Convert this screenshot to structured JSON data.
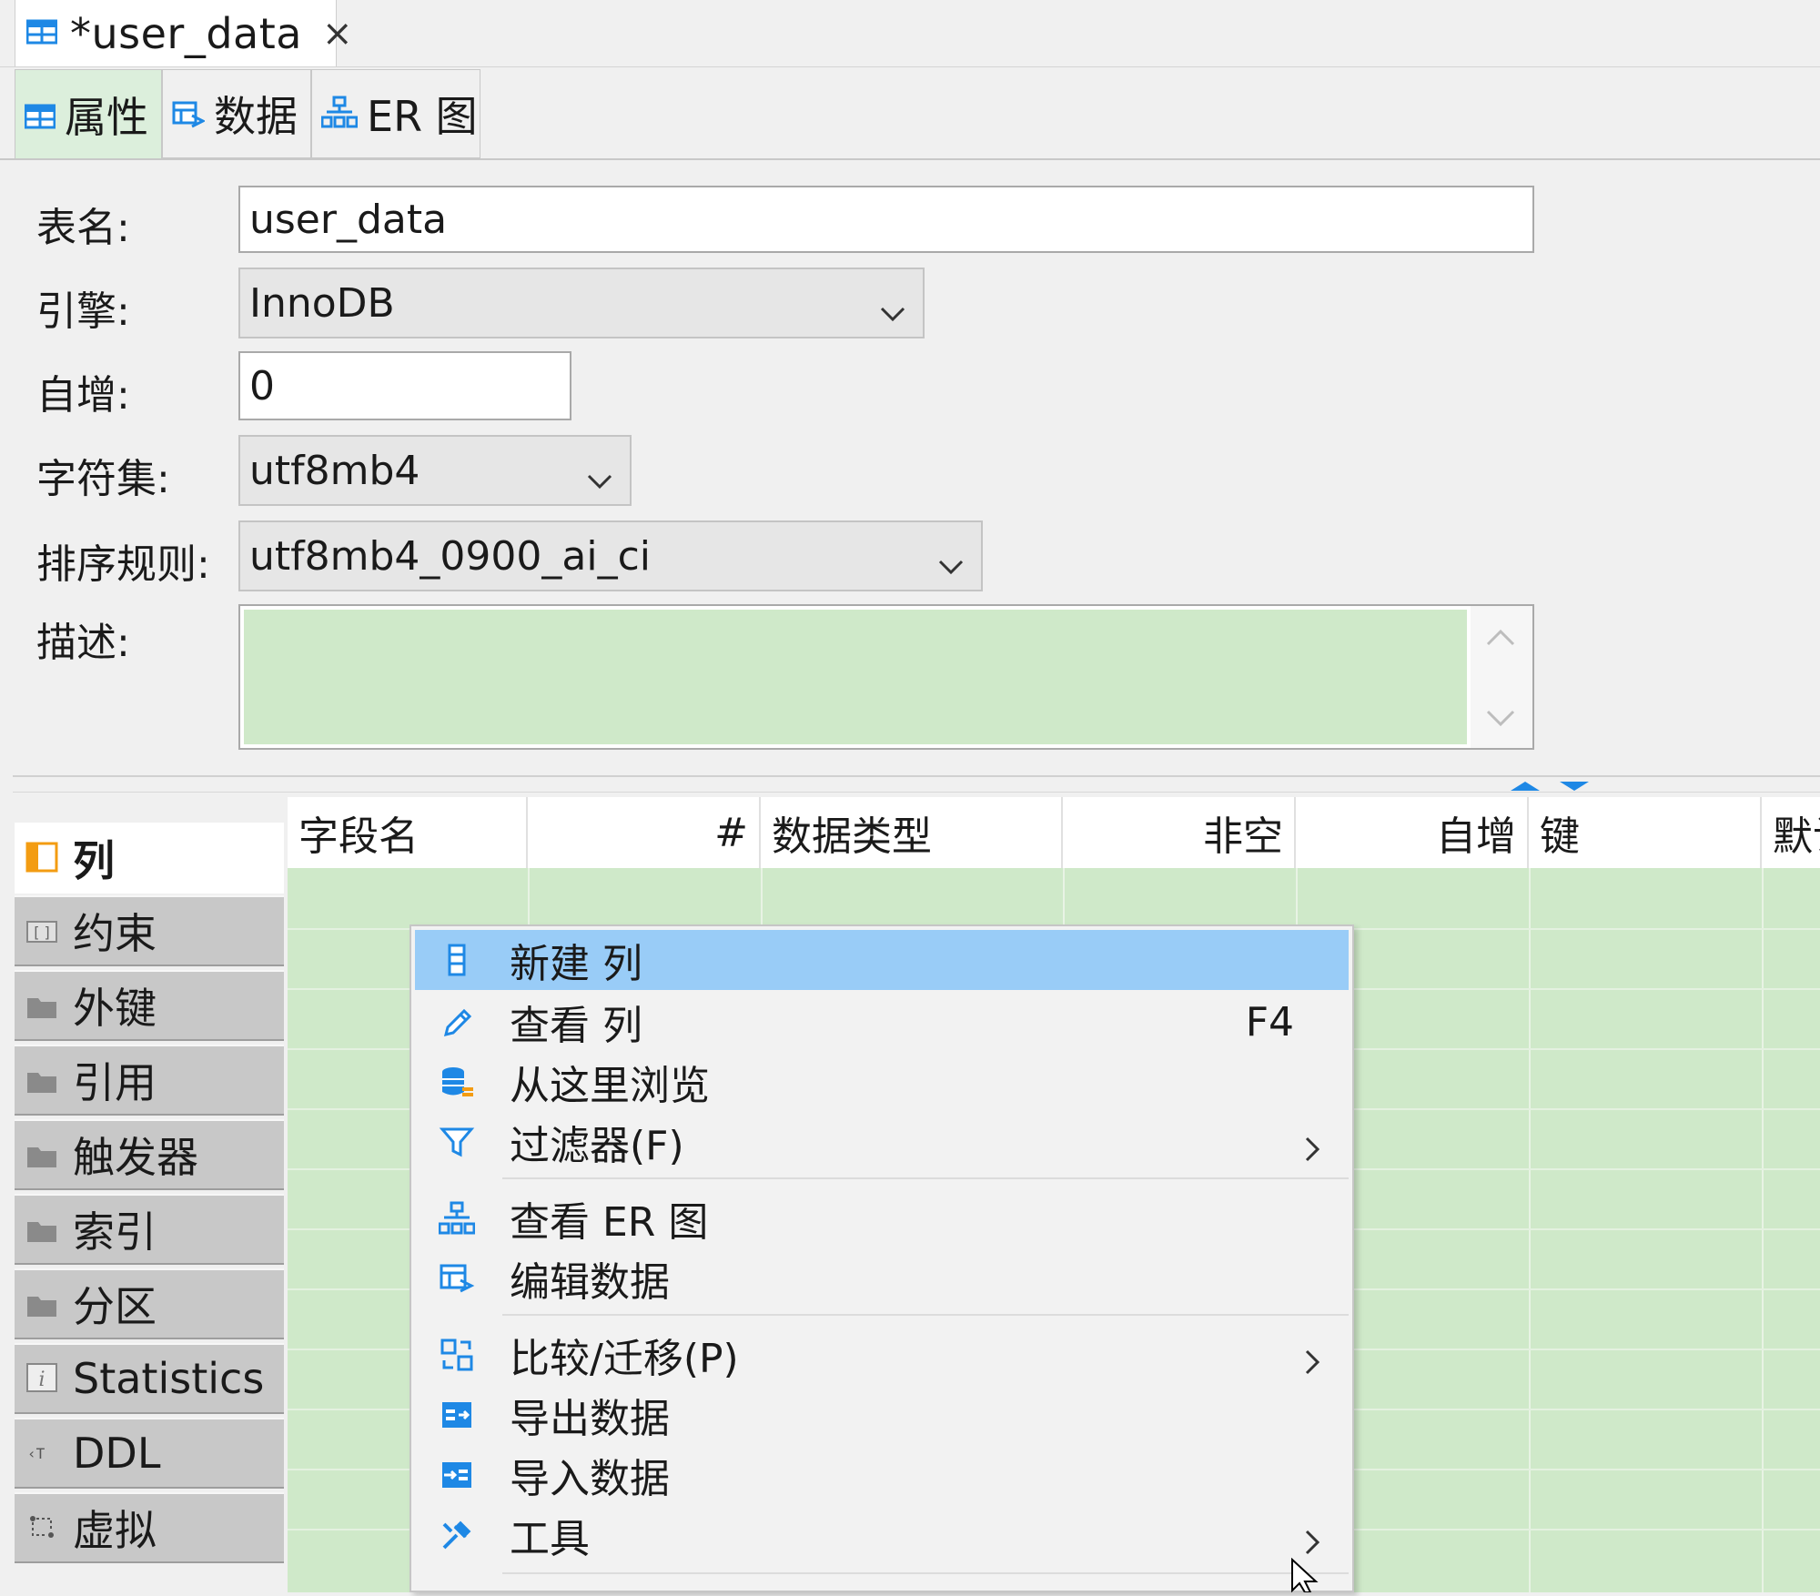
{
  "editor_tab": {
    "title": "*user_data",
    "close": "×"
  },
  "sub_tabs": [
    {
      "label": "属性",
      "icon": "table-icon",
      "active": true
    },
    {
      "label": "数据",
      "icon": "data-edit-icon",
      "active": false
    },
    {
      "label": "ER 图",
      "icon": "er-diagram-icon",
      "active": false
    }
  ],
  "form": {
    "table_name": {
      "label": "表名:",
      "value": "user_data"
    },
    "engine": {
      "label": "引擎:",
      "value": "InnoDB"
    },
    "auto_increment": {
      "label": "自增:",
      "value": "0"
    },
    "charset": {
      "label": "字符集:",
      "value": "utf8mb4"
    },
    "collation": {
      "label": "排序规则:",
      "value": "utf8mb4_0900_ai_ci"
    },
    "description": {
      "label": "描述:",
      "value": ""
    }
  },
  "left_tabs": [
    {
      "label": "列",
      "icon": "columns-icon",
      "active": true
    },
    {
      "label": "约束",
      "icon": "constraint-folder-icon"
    },
    {
      "label": "外键",
      "icon": "folder-icon"
    },
    {
      "label": "引用",
      "icon": "folder-icon"
    },
    {
      "label": "触发器",
      "icon": "folder-icon"
    },
    {
      "label": "索引",
      "icon": "folder-icon"
    },
    {
      "label": "分区",
      "icon": "folder-icon"
    },
    {
      "label": "Statistics",
      "icon": "info-icon"
    },
    {
      "label": "DDL",
      "icon": "ddl-icon"
    },
    {
      "label": "虚拟",
      "icon": "virtual-icon"
    }
  ],
  "grid": {
    "columns": [
      "字段名",
      "#",
      "数据类型",
      "非空",
      "自增",
      "键",
      "默认"
    ]
  },
  "context_menu": {
    "items": [
      {
        "label": "新建 列",
        "icon": "new-column-icon",
        "shortcut": "",
        "submenu": false,
        "highlighted": true
      },
      {
        "label": "查看 列",
        "icon": "pencil-icon",
        "shortcut": "F4",
        "submenu": false
      },
      {
        "label": "从这里浏览",
        "icon": "database-browse-icon",
        "shortcut": "",
        "submenu": false
      },
      {
        "label": "过滤器(F)",
        "icon": "filter-icon",
        "shortcut": "",
        "submenu": true
      },
      {
        "label": "查看 ER 图",
        "icon": "er-diagram-icon",
        "shortcut": "",
        "submenu": false
      },
      {
        "label": "编辑数据",
        "icon": "data-edit-icon",
        "shortcut": "",
        "submenu": false
      },
      {
        "label": "比较/迁移(P)",
        "icon": "compare-icon",
        "shortcut": "",
        "submenu": true
      },
      {
        "label": "导出数据",
        "icon": "export-icon",
        "shortcut": "",
        "submenu": false
      },
      {
        "label": "导入数据",
        "icon": "import-icon",
        "shortcut": "",
        "submenu": false
      },
      {
        "label": "工具",
        "icon": "tools-icon",
        "shortcut": "",
        "submenu": true
      }
    ]
  },
  "colors": {
    "active_tab_bg": "#dcefdc",
    "description_bg": "#cfe9c9",
    "grid_bg": "#cfe9c9",
    "menu_highlight": "#99ccf7",
    "icon_blue": "#1e88e5",
    "icon_orange": "#f39c12"
  }
}
